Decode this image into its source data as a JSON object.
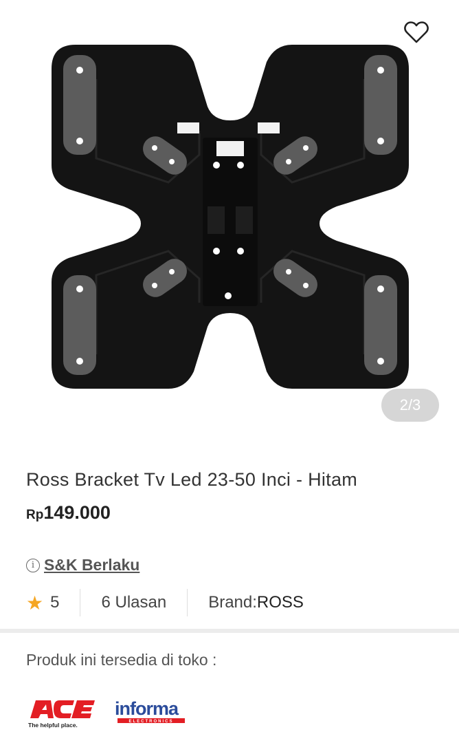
{
  "product": {
    "image_pager": "2/3",
    "title": "Ross Bracket Tv Led 23-50 Inci - Hitam",
    "price_currency": "Rp",
    "price_amount": "149.000",
    "terms_icon": "i",
    "terms_label": "S&K Berlaku",
    "rating": "5",
    "reviews": "6 Ulasan",
    "brand_label": "Brand: ",
    "brand_value": "ROSS"
  },
  "stores": {
    "heading": "Produk ini tersedia di toko :",
    "ace": {
      "name": "ACE",
      "tagline": "The helpful place."
    },
    "informa": {
      "name": "informa",
      "sub": "ELECTRONICS"
    }
  },
  "icons": {
    "wishlist": "heart-outline-icon",
    "rating": "star-icon",
    "terms": "info-icon"
  },
  "colors": {
    "star": "#f5a623",
    "ace_red": "#e31e24",
    "informa_red": "#e31e24",
    "informa_blue": "#2b4c9b"
  }
}
